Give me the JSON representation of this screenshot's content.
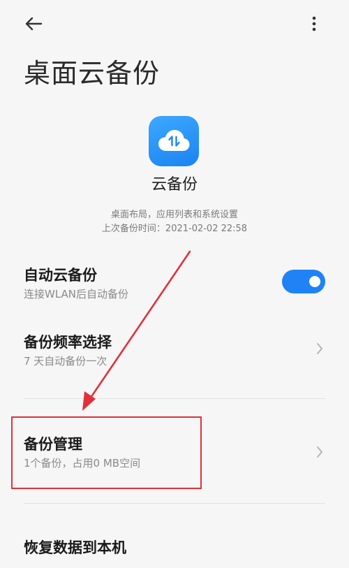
{
  "header": {
    "back_icon": "arrow-left-icon",
    "more_icon": "more-vertical-icon"
  },
  "page": {
    "title": "桌面云备份"
  },
  "app": {
    "icon": "cloud-sync-icon",
    "name": "云备份",
    "accent_color": "#1f82f5",
    "desc_line1": "桌面布局，应用列表和系统设置",
    "desc_line2": "上次备份时间：2021-02-02 22:58"
  },
  "settings": {
    "auto_backup": {
      "title": "自动云备份",
      "subtitle": "连接WLAN后自动备份",
      "enabled": true
    },
    "frequency": {
      "title": "备份频率选择",
      "subtitle": "7 天自动备份一次"
    },
    "manage": {
      "title": "备份管理",
      "subtitle": "1个备份，占用0 MB空间"
    },
    "restore": {
      "title": "恢复数据到本机"
    }
  },
  "annotation": {
    "color": "#e0313a"
  }
}
